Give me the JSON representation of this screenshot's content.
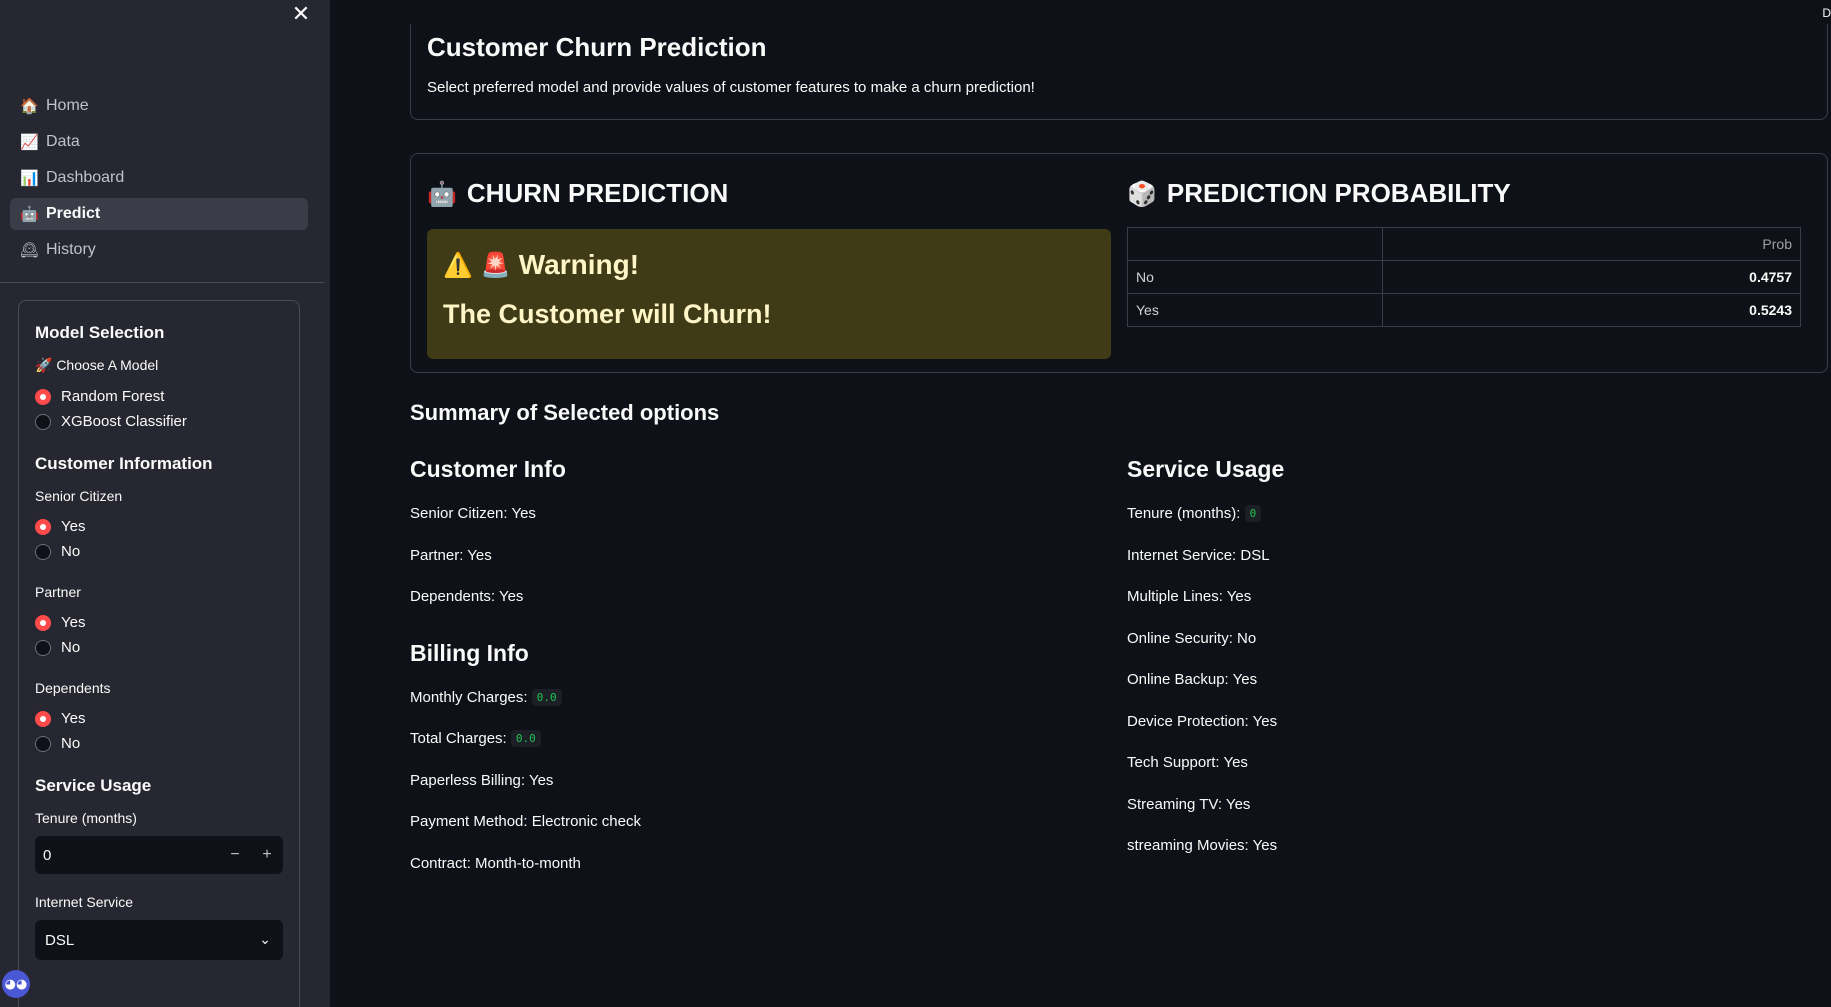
{
  "sidebar": {
    "nav": [
      {
        "icon": "🏠",
        "label": "Home"
      },
      {
        "icon": "📈",
        "label": "Data"
      },
      {
        "icon": "📊",
        "label": "Dashboard"
      },
      {
        "icon": "🤖",
        "label": "Predict",
        "active": true
      },
      {
        "icon": "🕰",
        "label": "History"
      }
    ],
    "form": {
      "model_heading": "Model Selection",
      "choose_label": "🚀 Choose A Model",
      "models": [
        "Random Forest",
        "XGBoost Classifier"
      ],
      "selected_model": "Random Forest",
      "customer_heading": "Customer Information",
      "senior_label": "Senior Citizen",
      "partner_label": "Partner",
      "dependents_label": "Dependents",
      "yes": "Yes",
      "no": "No",
      "service_heading": "Service Usage",
      "tenure_label": "Tenure (months)",
      "tenure_value": "0",
      "minus": "−",
      "plus": "+",
      "internet_label": "Internet Service",
      "internet_value": "DSL"
    }
  },
  "main": {
    "top_right_char": "D",
    "title": "Customer Churn Prediction",
    "subtitle": "Select preferred model and provide values of customer features to make a churn prediction!",
    "prediction": {
      "heading": "CHURN PREDICTION",
      "warning_title": "Warning!",
      "warning_message": "The Customer will Churn!"
    },
    "probability": {
      "heading": "PREDICTION PROBABILITY",
      "column": "Prob",
      "rows": [
        {
          "label": "No",
          "value": "0.4757"
        },
        {
          "label": "Yes",
          "value": "0.5243"
        }
      ]
    },
    "summary": {
      "title": "Summary of Selected options",
      "customer_heading": "Customer Info",
      "customer": [
        "Senior Citizen: Yes",
        "Partner: Yes",
        "Dependents: Yes"
      ],
      "billing_heading": "Billing Info",
      "monthly_label": "Monthly Charges:",
      "monthly_value": "0.0",
      "total_label": "Total Charges:",
      "total_value": "0.0",
      "paperless": "Paperless Billing: Yes",
      "payment": "Payment Method: Electronic check",
      "contract": "Contract: Month-to-month",
      "service_heading": "Service Usage",
      "tenure_label": "Tenure (months):",
      "tenure_value": "0",
      "service": [
        "Internet Service: DSL",
        "Multiple Lines: Yes",
        "Online Security: No",
        "Online Backup: Yes",
        "Device Protection: Yes",
        "Tech Support: Yes",
        "Streaming TV: Yes",
        "streaming Movies: Yes"
      ]
    }
  },
  "colors": {
    "background": "#0e1117",
    "sidebar": "#262730",
    "accent": "#ff4b4b",
    "warning_bg": "#3e3b16",
    "code_text": "#21c354"
  }
}
